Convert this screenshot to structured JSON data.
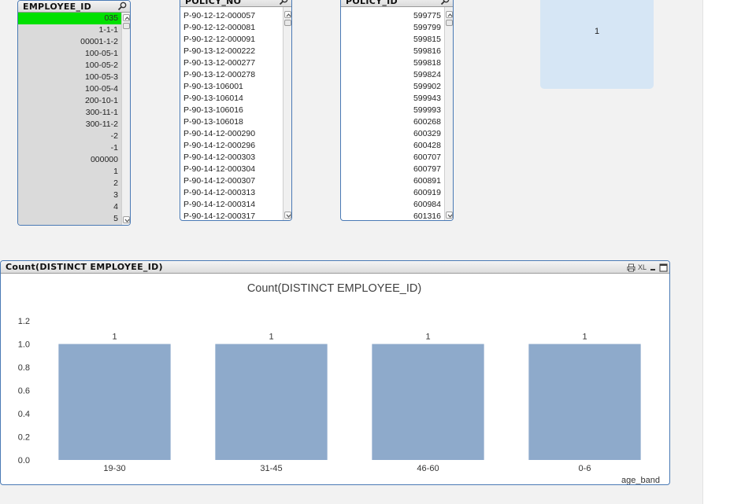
{
  "listboxes": {
    "employee_id": {
      "title": "EMPLOYEE_ID",
      "items": [
        "035",
        "1-1-1",
        "00001-1-2",
        "100-05-1",
        "100-05-2",
        "100-05-3",
        "100-05-4",
        "200-10-1",
        "300-11-1",
        "300-11-2",
        "-2",
        "-1",
        "000000",
        "1",
        "2",
        "3",
        "4",
        "5"
      ],
      "selected": "035"
    },
    "policy_no": {
      "title": "POLICY_NO",
      "items": [
        "P-90-12-12-000057",
        "P-90-12-12-000081",
        "P-90-12-12-000091",
        "P-90-13-12-000222",
        "P-90-13-12-000277",
        "P-90-13-12-000278",
        "P-90-13-106001",
        "P-90-13-106014",
        "P-90-13-106016",
        "P-90-13-106018",
        "P-90-14-12-000290",
        "P-90-14-12-000296",
        "P-90-14-12-000303",
        "P-90-14-12-000304",
        "P-90-14-12-000307",
        "P-90-14-12-000313",
        "P-90-14-12-000314",
        "P-90-14-12-000317"
      ]
    },
    "policy_id": {
      "title": "POLICY_ID",
      "items": [
        "599775",
        "599799",
        "599815",
        "599816",
        "599818",
        "599824",
        "599902",
        "599943",
        "599993",
        "600268",
        "600329",
        "600428",
        "600707",
        "600797",
        "600891",
        "600919",
        "600984",
        "601316"
      ]
    }
  },
  "stat_box": {
    "value": "1"
  },
  "chart_object": {
    "header_title": "Count(DISTINCT  EMPLOYEE_ID)",
    "tools": {
      "xl_label": "XL"
    }
  },
  "chart_data": {
    "type": "bar",
    "title": "Count(DISTINCT EMPLOYEE_ID)",
    "xlabel": "age_band",
    "ylabel": "",
    "categories": [
      "19-30",
      "31-45",
      "46-60",
      "0-6"
    ],
    "values": [
      1,
      1,
      1,
      1
    ],
    "data_labels": [
      "1",
      "1",
      "1",
      "1"
    ],
    "y_ticks": [
      "0.0",
      "0.2",
      "0.4",
      "0.6",
      "0.8",
      "1.0",
      "1.2"
    ],
    "ylim": [
      0,
      1.2
    ],
    "bar_color": "#8eaacb",
    "grid": false
  },
  "colors": {
    "selected": "#00e000",
    "excluded": "#dadada",
    "border": "#4a7ab5",
    "stat_bg": "#d6e6f5"
  }
}
